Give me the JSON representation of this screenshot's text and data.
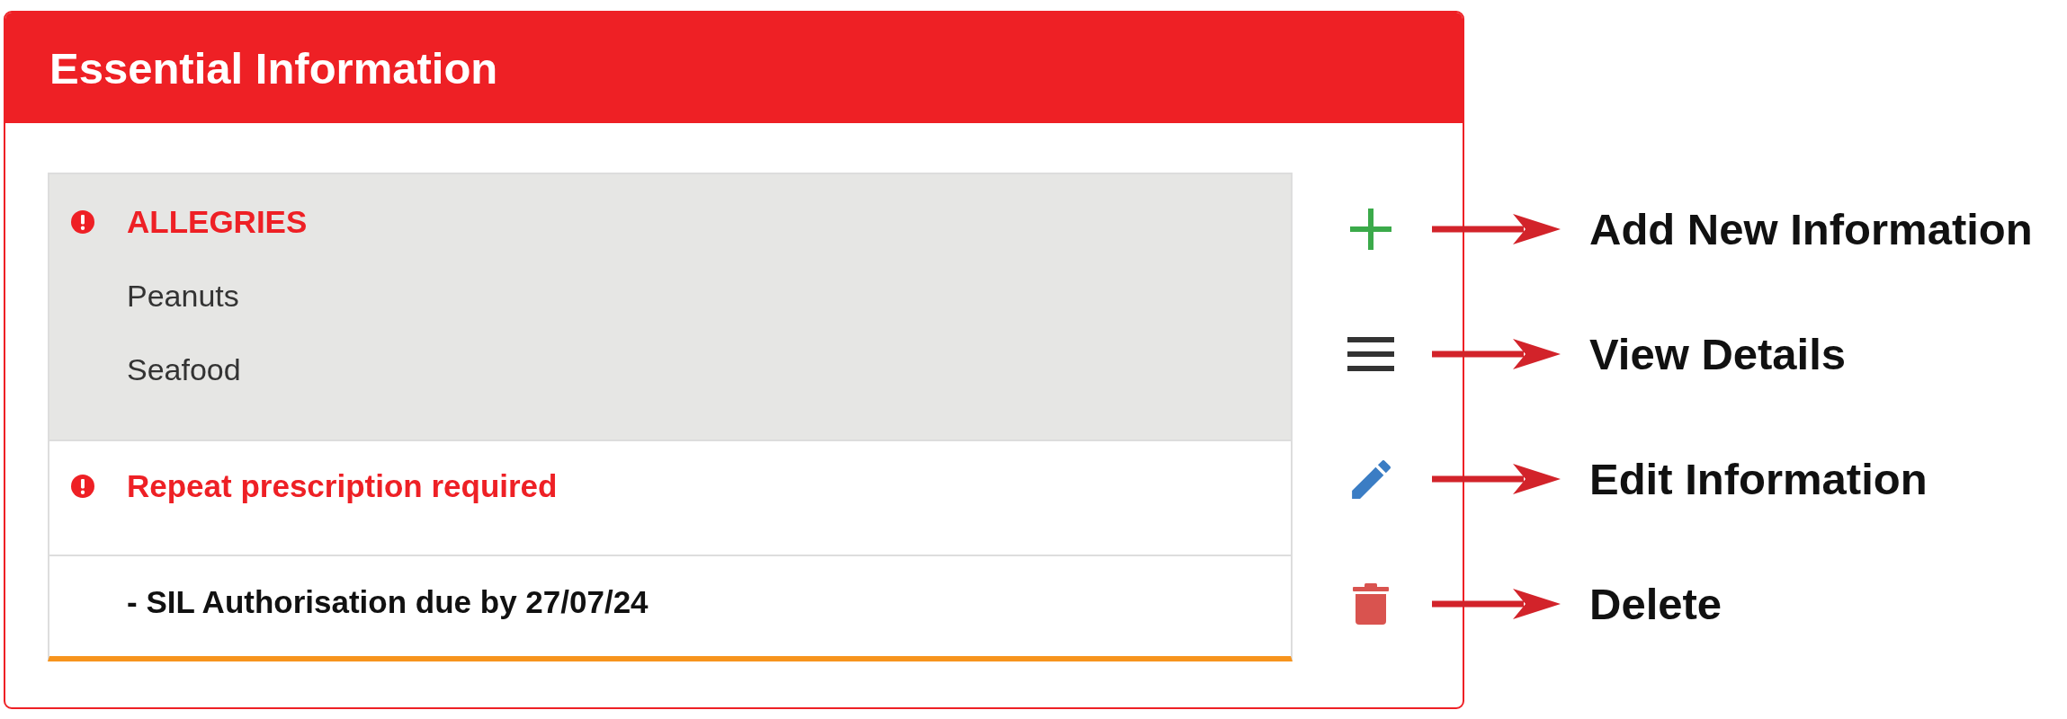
{
  "panel": {
    "title": "Essential Information"
  },
  "items": [
    {
      "kind": "alert-group",
      "selected": true,
      "title": "ALLEGRIES",
      "entries": [
        "Peanuts",
        "Seafood"
      ]
    },
    {
      "kind": "alert",
      "selected": false,
      "title": "Repeat prescription required"
    },
    {
      "kind": "note",
      "selected": false,
      "title": "- SIL Authorisation due by 27/07/24"
    }
  ],
  "actions": [
    {
      "kind": "add",
      "callout": "Add New Information"
    },
    {
      "kind": "details",
      "callout": "View Details"
    },
    {
      "kind": "edit",
      "callout": "Edit Information"
    },
    {
      "kind": "delete",
      "callout": "Delete"
    }
  ]
}
